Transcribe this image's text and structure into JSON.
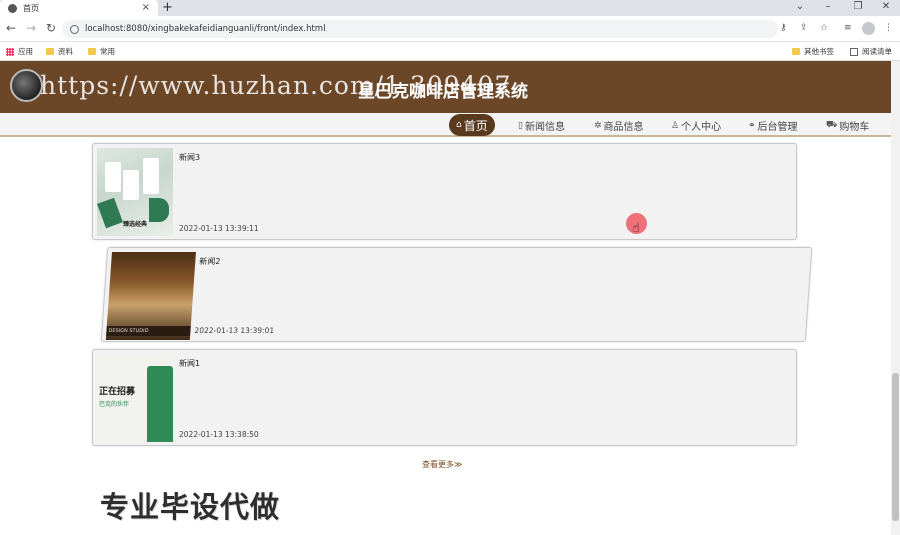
{
  "browser": {
    "tab_title": "首页",
    "tab_close": "×",
    "new_tab": "+",
    "url": "localhost:8080/xingbakekafeidianguanli/front/index.html",
    "window_controls": [
      "⌄",
      "–",
      "❐",
      "✕"
    ],
    "bookmarks": {
      "apps": "应用",
      "folder1": "资料",
      "folder2": "常用",
      "other": "其他书签",
      "reading_list": "阅读清单"
    }
  },
  "site": {
    "watermark_url": "https://www.huzhan.com/1 309407",
    "title": "星巴克咖啡店管理系统",
    "nav": [
      {
        "icon": "⌂",
        "label": "首页"
      },
      {
        "icon": "▯",
        "label": "新闻信息"
      },
      {
        "icon": "✲",
        "label": "商品信息"
      },
      {
        "icon": "♙",
        "label": "个人中心"
      },
      {
        "icon": "⚭",
        "label": "后台管理"
      },
      {
        "icon": "⛟",
        "label": "购物车"
      }
    ]
  },
  "news": [
    {
      "title": "新闻3",
      "time": "2022-01-13 13:39:11",
      "image_caption": "臻选经典"
    },
    {
      "title": "新闻2",
      "time": "2022-01-13 13:39:01",
      "image_caption": "DESIGN STUDIO"
    },
    {
      "title": "新闻1",
      "time": "2022-01-13 13:38:50",
      "image_text1": "正在招募",
      "image_text2": "巴克的伙伴"
    }
  ],
  "more_link": "查看更多≫",
  "overlay_text": "专业毕设代做",
  "colors": {
    "header_brown": "#6b4728",
    "nav_active": "#5a3a1f",
    "cursor": "#ec505a"
  }
}
